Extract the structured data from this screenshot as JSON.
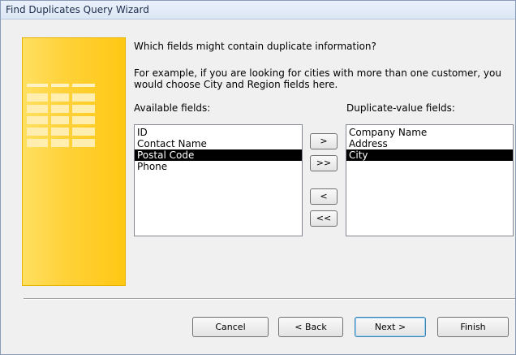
{
  "window": {
    "title": "Find Duplicates Query Wizard"
  },
  "prompt": {
    "question": "Which fields might contain duplicate information?",
    "example_line1": "For example, if you are looking for cities with more than one customer, you",
    "example_line2": "would choose City and Region fields here."
  },
  "available": {
    "label": "Available fields:",
    "items": [
      "ID",
      "Contact Name",
      "Postal Code",
      "Phone"
    ],
    "selected": "Postal Code"
  },
  "duplicate": {
    "label": "Duplicate-value fields:",
    "items": [
      "Company Name",
      "Address",
      "City"
    ],
    "selected": "City"
  },
  "transfer": {
    "add_one": ">",
    "add_all": ">>",
    "remove_one": "<",
    "remove_all": "<<"
  },
  "footer": {
    "cancel": "Cancel",
    "back": "< Back",
    "next": "Next >",
    "finish": "Finish"
  }
}
